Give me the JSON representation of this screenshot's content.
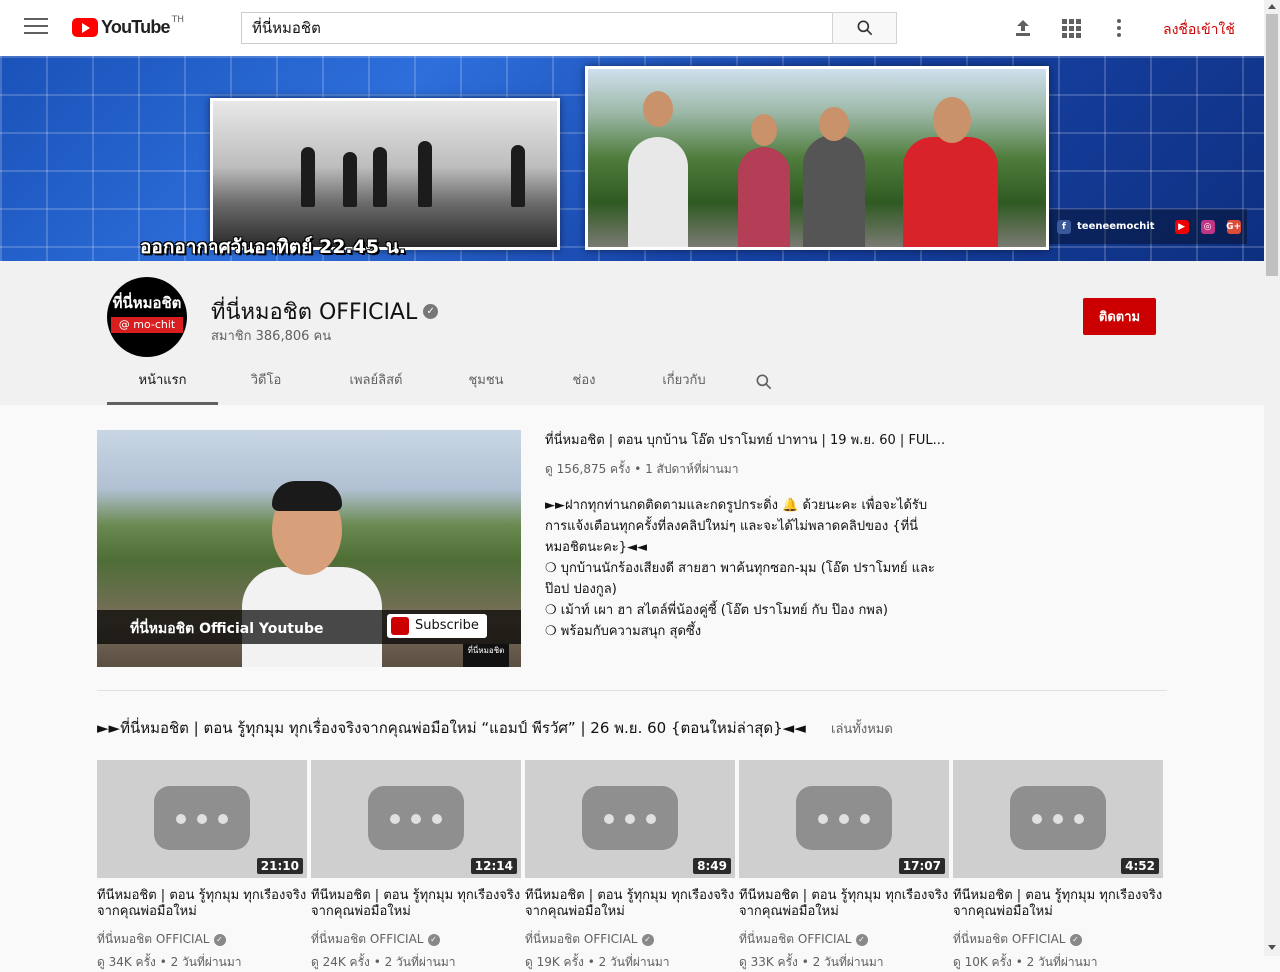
{
  "header": {
    "logo_text": "YouTube",
    "logo_country": "TH",
    "search_value": "ที่นี่หมอชิต",
    "sign_in": "ลงชื่อเข้าใช้"
  },
  "banner": {
    "caption": "ออกอากาศวันอาทิตย์ 22.45 น.",
    "social_handle": "teeneemochit",
    "social_icons": [
      "facebook-icon",
      "youtube-icon",
      "instagram-icon",
      "google-plus-icon"
    ]
  },
  "channel": {
    "avatar_top": "ที่นี่หมอชิต",
    "avatar_bottom": "@ mo-chit",
    "name": "ที่นี่หมอชิต OFFICIAL",
    "subscribers": "สมาชิก 386,806 คน",
    "subscribe_label": "ติดตาม",
    "tabs": [
      {
        "label": "หน้าแรก"
      },
      {
        "label": "วิดีโอ"
      },
      {
        "label": "เพลย์ลิสต์"
      },
      {
        "label": "ชุมชน"
      },
      {
        "label": "ช่อง"
      },
      {
        "label": "เกี่ยวกับ"
      }
    ]
  },
  "featured": {
    "thumb_strip_text": "ที่นี่หมอชิต Official Youtube",
    "thumb_subscribe": "Subscribe",
    "thumb_logo": "ที่นี่หมอชิต",
    "title": "ที่นี่หมอชิต | ตอน บุกบ้าน โอ๊ต ปราโมทย์ ปาทาน | 19 พ.ย. 60 | FUL...",
    "meta": "ดู 156,875 ครั้ง • 1 สัปดาห์ที่ผ่านมา",
    "description": [
      "►►ฝากทุกท่านกดติดตามและกดรูปกระดิ่ง 🔔 ด้วยนะคะ เพื่อจะได้รับการแจ้งเตือนทุกครั้งที่ลงคลิปใหม่ๆ และจะได้ไม่พลาดคลิปของ {ที่นี่หมอชิตนะคะ}◄◄",
      "❍ บุกบ้านนักร้องเสียงดี สายฮา พาค้นทุกซอก-มุม (โอ๊ต ปราโมทย์ และ ป๊อป ปองกูล)",
      "❍ เม้าท์ เผา ฮา สไตล์พี่น้องคู่ซี้ (โอ๊ต ปราโมทย์ กับ ป๊อง กพล)",
      "❍ พร้อมกับความสนุก สุดซึ้ง"
    ]
  },
  "shelf": {
    "title": "►►ที่นี่หมอชิต | ตอน รู้ทุกมุม ทุกเรื่องจริงจากคุณพ่อมือใหม่ “แอมป์ พีรวัศ” | 26 พ.ย. 60 {ตอนใหม่ล่าสุด}◄◄",
    "play_all": "เล่นทั้งหมด",
    "videos": [
      {
        "duration": "21:10",
        "title": "ที่นี่หมอชิต | ตอน รู้ทุกมุม ทุกเรื่องจริงจากคุณพ่อมือใหม่",
        "channel": "ที่นี่หมอชิต OFFICIAL",
        "meta": "ดู 34K ครั้ง • 2 วันที่ผ่านมา"
      },
      {
        "duration": "12:14",
        "title": "ที่นี่หมอชิต | ตอน รู้ทุกมุม ทุกเรื่องจริงจากคุณพ่อมือใหม่",
        "channel": "ที่นี่หมอชิต OFFICIAL",
        "meta": "ดู 24K ครั้ง • 2 วันที่ผ่านมา"
      },
      {
        "duration": "8:49",
        "title": "ที่นี่หมอชิต | ตอน รู้ทุกมุม ทุกเรื่องจริงจากคุณพ่อมือใหม่",
        "channel": "ที่นี่หมอชิต OFFICIAL",
        "meta": "ดู 19K ครั้ง • 2 วันที่ผ่านมา"
      },
      {
        "duration": "17:07",
        "title": "ที่นี่หมอชิต | ตอน รู้ทุกมุม ทุกเรื่องจริงจากคุณพ่อมือใหม่",
        "channel": "ที่นี่หมอชิต OFFICIAL",
        "meta": "ดู 33K ครั้ง • 2 วันที่ผ่านมา"
      },
      {
        "duration": "4:52",
        "title": "ที่นี่หมอชิต | ตอน รู้ทุกมุม ทุกเรื่องจริงจากคุณพ่อมือใหม่",
        "channel": "ที่นี่หมอชิต OFFICIAL",
        "meta": "ดู 10K ครั้ง • 2 วันที่ผ่านมา"
      }
    ]
  }
}
